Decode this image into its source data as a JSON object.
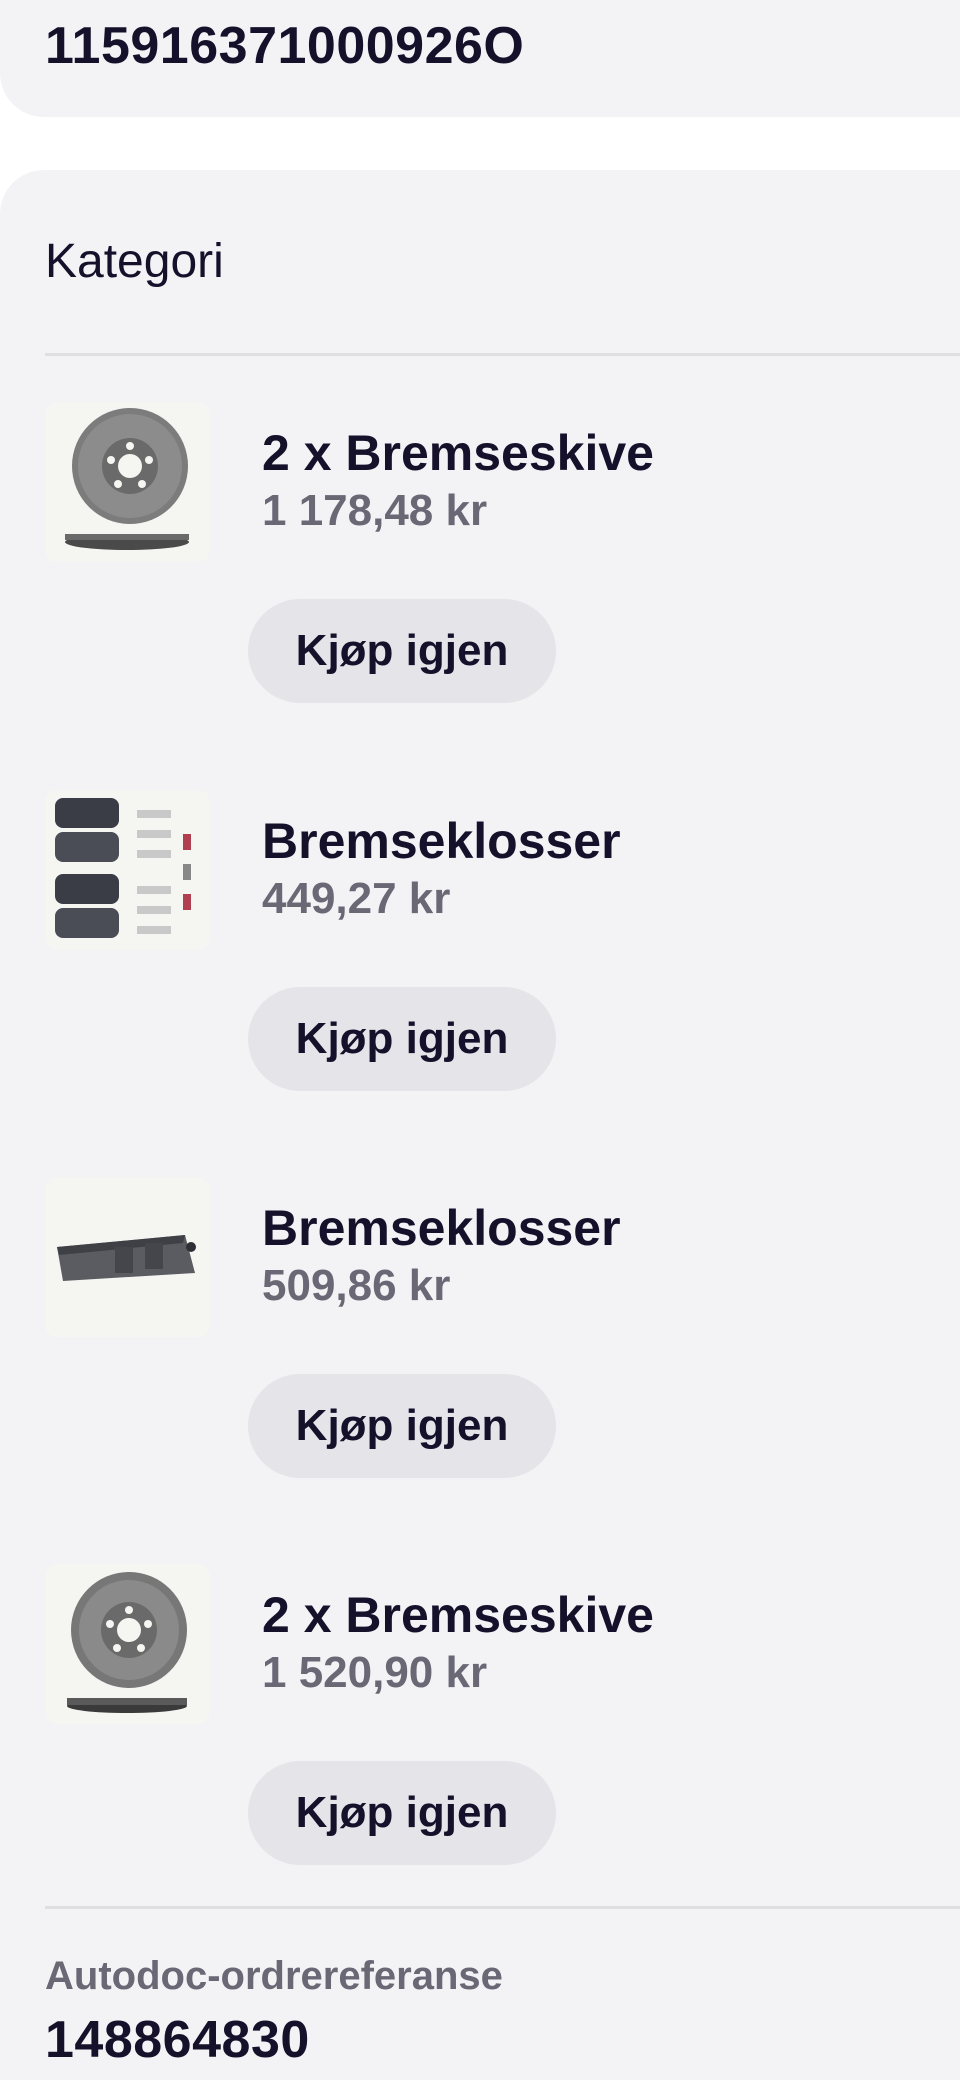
{
  "top_card": {
    "number": "115916371000926O"
  },
  "category": {
    "heading": "Kategori"
  },
  "items": [
    {
      "title": "2 x Bremseskive",
      "price": "1 178,48 kr",
      "button": "Kjøp igjen",
      "image": "brake-disc"
    },
    {
      "title": "Bremseklosser",
      "price": "449,27 kr",
      "button": "Kjøp igjen",
      "image": "brake-pads-set"
    },
    {
      "title": "Bremseklosser",
      "price": "509,86 kr",
      "button": "Kjøp igjen",
      "image": "brake-pads"
    },
    {
      "title": "2 x Bremseskive",
      "price": "1 520,90 kr",
      "button": "Kjøp igjen",
      "image": "brake-disc"
    }
  ],
  "order_reference": {
    "label": "Autodoc-ordrereferanse",
    "value": "148864830"
  }
}
